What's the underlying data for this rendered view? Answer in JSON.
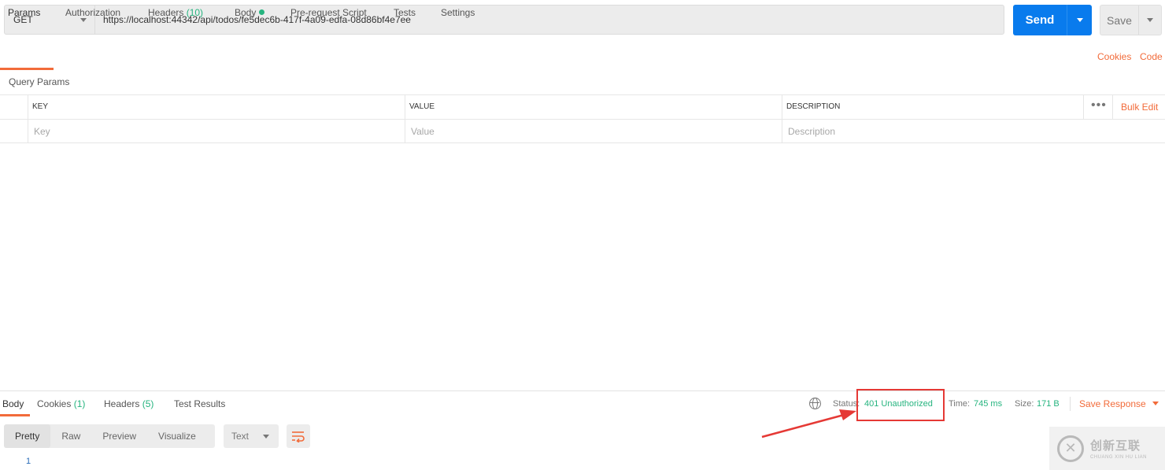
{
  "request": {
    "method": "GET",
    "url": "https://localhost:44342/api/todos/fe5dec6b-417f-4a09-edfa-08d86bf4e7ee",
    "send_label": "Send",
    "save_label": "Save"
  },
  "tabs": {
    "params": "Params",
    "authorization": "Authorization",
    "headers": "Headers",
    "headers_count": "(10)",
    "body": "Body",
    "prerequest": "Pre-request Script",
    "tests": "Tests",
    "settings": "Settings",
    "cookies": "Cookies",
    "code": "Code"
  },
  "params": {
    "section_label": "Query Params",
    "col_key": "KEY",
    "col_value": "VALUE",
    "col_description": "DESCRIPTION",
    "more": "•••",
    "bulk_edit": "Bulk Edit",
    "key_placeholder": "Key",
    "value_placeholder": "Value",
    "description_placeholder": "Description"
  },
  "response": {
    "tabs": {
      "body": "Body",
      "cookies": "Cookies",
      "cookies_count": "(1)",
      "headers": "Headers",
      "headers_count": "(5)",
      "test_results": "Test Results"
    },
    "status_label": "Status:",
    "status_value": "401 Unauthorized",
    "time_label": "Time:",
    "time_value": "745 ms",
    "size_label": "Size:",
    "size_value": "171 B",
    "save_response": "Save Response",
    "views": {
      "pretty": "Pretty",
      "raw": "Raw",
      "preview": "Preview",
      "visualize": "Visualize"
    },
    "format": "Text",
    "line_number": "1"
  },
  "watermark": {
    "main": "创新互联",
    "sub": "CHUANG XIN HU LIAN"
  },
  "colors": {
    "accent": "#f26b3a",
    "send_blue": "#097bed",
    "status_green": "#26b47f",
    "annotation_red": "#e53935"
  }
}
